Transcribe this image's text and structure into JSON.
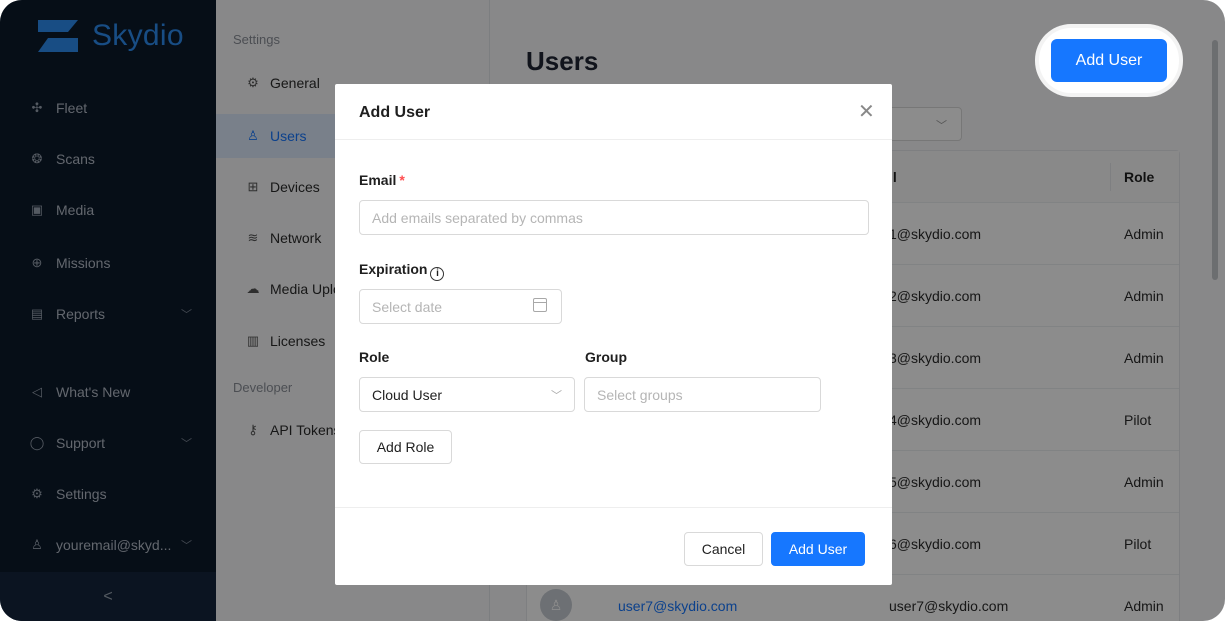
{
  "brand": {
    "name": "Skydio",
    "accent": "#1677ff",
    "logo_color": "#2c8cf0"
  },
  "sidebar": {
    "items": [
      {
        "label": "Fleet",
        "icon": "fleet-icon"
      },
      {
        "label": "Scans",
        "icon": "scans-icon"
      },
      {
        "label": "Media",
        "icon": "media-icon"
      },
      {
        "label": "Missions",
        "icon": "missions-icon"
      },
      {
        "label": "Reports",
        "icon": "reports-icon"
      },
      {
        "label": "What's New",
        "icon": "megaphone-icon"
      },
      {
        "label": "Support",
        "icon": "chat-icon"
      },
      {
        "label": "Settings",
        "icon": "gear-icon"
      },
      {
        "label": "youremail@skyd...",
        "icon": "user-icon"
      }
    ],
    "collapse_glyph": "<"
  },
  "settings_panel": {
    "heading": "Settings",
    "developer_heading": "Developer",
    "items": [
      {
        "label": "General",
        "icon": "gear-icon"
      },
      {
        "label": "Users",
        "icon": "users-icon"
      },
      {
        "label": "Devices",
        "icon": "devices-icon"
      },
      {
        "label": "Network",
        "icon": "wifi-icon"
      },
      {
        "label": "Media Uplo",
        "icon": "cloud-upload-icon"
      },
      {
        "label": "Licenses",
        "icon": "barcode-icon"
      }
    ],
    "developer_items": [
      {
        "label": "API Tokens",
        "icon": "key-icon"
      }
    ],
    "active": "Users"
  },
  "main": {
    "title": "Users",
    "add_user_label": "Add User",
    "table": {
      "col_email_partial": "il",
      "col_role": "Role",
      "rows": [
        {
          "email": "1@skydio.com",
          "role": "Admin"
        },
        {
          "email": "2@skydio.com",
          "role": "Admin"
        },
        {
          "email": "3@skydio.com",
          "role": "Admin"
        },
        {
          "email": "4@skydio.com",
          "role": "Pilot"
        },
        {
          "email": "5@skydio.com",
          "role": "Admin"
        },
        {
          "email": "6@skydio.com",
          "role": "Pilot"
        },
        {
          "name": "user7@skydio.com",
          "email": "user7@skydio.com",
          "role": "Admin"
        }
      ]
    }
  },
  "modal": {
    "title": "Add User",
    "email_label": "Email",
    "required_mark": "*",
    "email_placeholder": "Add emails separated by commas",
    "expiration_label": "Expiration",
    "info_glyph": "i",
    "date_placeholder": "Select date",
    "role_label": "Role",
    "group_label": "Group",
    "role_value": "Cloud User",
    "group_placeholder": "Select groups",
    "add_role_label": "Add Role",
    "cancel_label": "Cancel",
    "submit_label": "Add User"
  }
}
